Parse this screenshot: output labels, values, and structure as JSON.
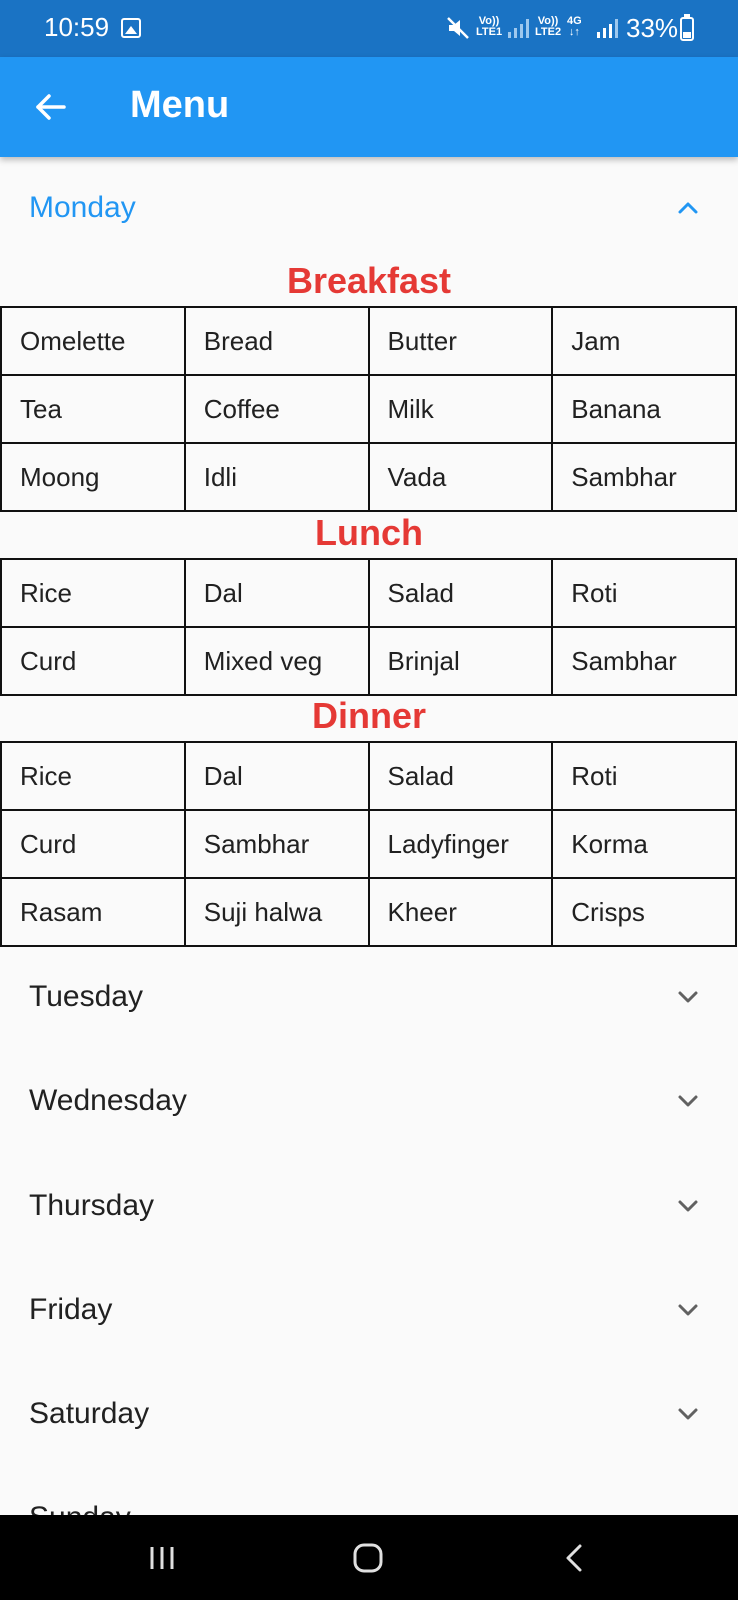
{
  "status_bar": {
    "time": "10:59",
    "net1": "Vo))\nLTE1",
    "net2": "Vo))\nLTE2",
    "net3": "4G\n↓↑",
    "battery": "33%",
    "icons": [
      "gallery-icon",
      "mute-icon",
      "signal-icon",
      "signal-icon",
      "battery-icon"
    ]
  },
  "app_bar": {
    "title": "Menu",
    "back_icon": "arrow-left-icon"
  },
  "days": [
    {
      "label": "Monday",
      "expanded": true
    },
    {
      "label": "Tuesday",
      "expanded": false
    },
    {
      "label": "Wednesday",
      "expanded": false
    },
    {
      "label": "Thursday",
      "expanded": false
    },
    {
      "label": "Friday",
      "expanded": false
    },
    {
      "label": "Saturday",
      "expanded": false
    },
    {
      "label": "Sunday",
      "expanded": false
    }
  ],
  "monday_meals": {
    "breakfast": {
      "title": "Breakfast",
      "rows": [
        [
          "Omelette",
          "Bread",
          "Butter",
          "Jam"
        ],
        [
          "Tea",
          "Coffee",
          "Milk",
          "Banana"
        ],
        [
          "Moong",
          "Idli",
          "Vada",
          "Sambhar"
        ]
      ]
    },
    "lunch": {
      "title": "Lunch",
      "rows": [
        [
          "Rice",
          "Dal",
          "Salad",
          "Roti"
        ],
        [
          "Curd",
          "Mixed veg",
          "Brinjal",
          "Sambhar"
        ]
      ]
    },
    "dinner": {
      "title": "Dinner",
      "rows": [
        [
          "Rice",
          "Dal",
          "Salad",
          "Roti"
        ],
        [
          "Curd",
          "Sambhar",
          "Ladyfinger",
          "Korma"
        ],
        [
          "Rasam",
          "Suji halwa",
          "Kheer",
          "Crisps"
        ]
      ]
    }
  },
  "colors": {
    "status_bar": "#1a73c4",
    "app_bar": "#2196f3",
    "expanded_day": "#2196f3",
    "meal_title": "#e53935",
    "background": "#fafafa",
    "nav_bar": "#000000"
  },
  "nav_bar": {
    "icons": [
      "recent-apps-icon",
      "home-icon",
      "back-icon"
    ]
  }
}
